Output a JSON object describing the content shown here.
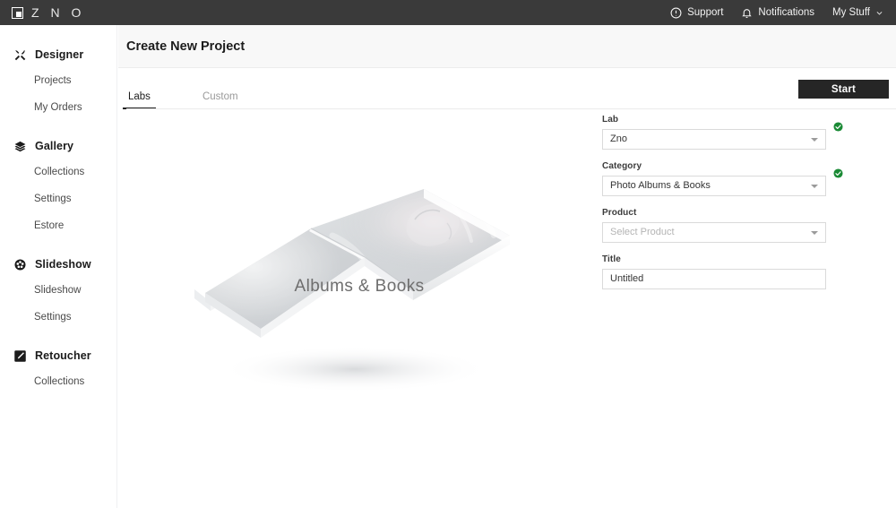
{
  "topbar": {
    "brand_text": "Z N O",
    "brand_icon": "zno-square-logo",
    "items": [
      {
        "label": "Support",
        "icon": "exclamation-circle-icon"
      },
      {
        "label": "Notifications",
        "icon": "bell-icon"
      },
      {
        "label": "My Stuff",
        "icon": "chevron-down-icon"
      }
    ]
  },
  "sidebar": {
    "groups": [
      {
        "label": "Designer",
        "icon": "crossed-tools-icon",
        "items": [
          {
            "label": "Projects"
          },
          {
            "label": "My Orders"
          }
        ]
      },
      {
        "label": "Gallery",
        "icon": "layers-icon",
        "items": [
          {
            "label": "Collections"
          },
          {
            "label": "Settings"
          },
          {
            "label": "Estore"
          }
        ]
      },
      {
        "label": "Slideshow",
        "icon": "film-reel-icon",
        "items": [
          {
            "label": "Slideshow"
          },
          {
            "label": "Settings"
          }
        ]
      },
      {
        "label": "Retoucher",
        "icon": "retouch-pencil-icon",
        "items": [
          {
            "label": "Collections"
          }
        ]
      }
    ]
  },
  "main": {
    "page_title": "Create New Project",
    "tabs": [
      {
        "label": "Labs",
        "active": true
      },
      {
        "label": "Custom",
        "active": false
      }
    ],
    "start_label": "Start",
    "preview": {
      "caption": "Albums & Books",
      "image": "open-photo-album-perspective"
    },
    "form": {
      "lab": {
        "label": "Lab",
        "value": "Zno",
        "valid": true
      },
      "category": {
        "label": "Category",
        "value": "Photo Albums & Books",
        "valid": true
      },
      "product": {
        "label": "Product",
        "value": "",
        "placeholder": "Select Product",
        "valid": false
      },
      "title": {
        "label": "Title",
        "value": "Untitled",
        "placeholder": "Untitled",
        "valid": false
      }
    }
  },
  "colors": {
    "topbar_bg": "#3a3a3a",
    "header_bg": "#f8f8f8",
    "accent_dark": "#262626",
    "valid_green": "#1a8a35",
    "border": "#dadada"
  }
}
